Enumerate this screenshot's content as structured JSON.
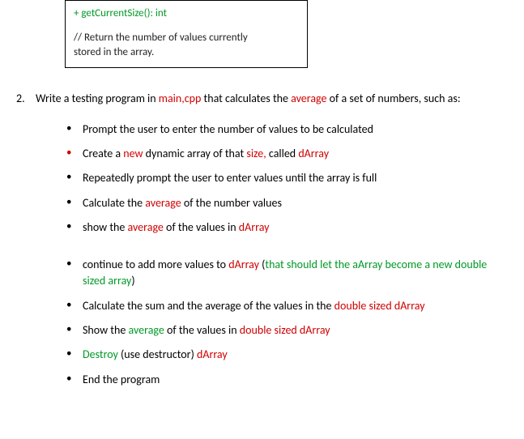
{
  "box": {
    "method": "+ getCurrentSize(): int",
    "comment_l1": "// Return the number of values currently",
    "comment_l2": "stored in the array."
  },
  "q": {
    "num": "2.",
    "t1": "Write a testing program in ",
    "main": "main,cpp",
    "t2": " that calculates the ",
    "avg": "average",
    "t3": " of a set of numbers, such as:"
  },
  "b1": "Prompt the user to enter the number of values to be calculated",
  "b2": {
    "a": "Create a ",
    "new": "new",
    "b": " dynamic array of that ",
    "size": "size,",
    "c": " called ",
    "d": "dArray"
  },
  "b3": "Repeatedly prompt the user to enter values until the array is full",
  "b4": {
    "a": "Calculate the ",
    "avg": "average",
    "b": " of the number values"
  },
  "b5": {
    "a": "show the ",
    "avg": "average",
    "b": " of the values in ",
    "d": "dArray"
  },
  "b6": {
    "a": "continue to add more values to ",
    "d": "dArray",
    "b": " (",
    "g": "that should let the aArray become a new double sized array",
    "c": ")"
  },
  "b7": {
    "a": "Calculate the sum and the average of the values in the ",
    "d": "double sized dArray"
  },
  "b8": {
    "a": "Show the ",
    "avg": "average",
    "b": " of the values in ",
    "d": "double sized dArray"
  },
  "b9": {
    "g": "Destroy",
    "a": "  (use destructor) ",
    "d": "dArray"
  },
  "b10": "End the program"
}
